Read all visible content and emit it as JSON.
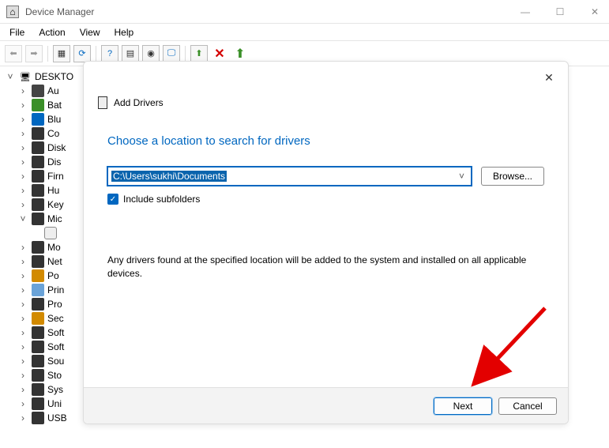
{
  "window": {
    "title": "Device Manager",
    "menus": {
      "file": "File",
      "action": "Action",
      "view": "View",
      "help": "Help"
    }
  },
  "tree": {
    "root": {
      "label": "DESKTO",
      "expanded": true
    },
    "items": [
      {
        "label": "Au",
        "color": "#444"
      },
      {
        "label": "Bat",
        "color": "#3a8f28"
      },
      {
        "label": "Blu",
        "color": "#0067c0"
      },
      {
        "label": "Co",
        "color": "#333"
      },
      {
        "label": "Disk",
        "color": "#333"
      },
      {
        "label": "Dis",
        "color": "#333"
      },
      {
        "label": "Firn",
        "color": "#333"
      },
      {
        "label": "Hu",
        "color": "#333"
      },
      {
        "label": "Key",
        "color": "#333"
      },
      {
        "label": "Mic",
        "color": "#333",
        "expanded": true,
        "child": ""
      },
      {
        "label": "Mo",
        "color": "#333"
      },
      {
        "label": "Net",
        "color": "#333"
      },
      {
        "label": "Po",
        "color": "#d28a00"
      },
      {
        "label": "Prin",
        "color": "#6aa3d8"
      },
      {
        "label": "Pro",
        "color": "#333"
      },
      {
        "label": "Sec",
        "color": "#d28a00"
      },
      {
        "label": "Soft",
        "color": "#333"
      },
      {
        "label": "Soft",
        "color": "#333"
      },
      {
        "label": "Sou",
        "color": "#333"
      },
      {
        "label": "Sto",
        "color": "#333"
      },
      {
        "label": "Sys",
        "color": "#333"
      },
      {
        "label": "Uni",
        "color": "#333"
      },
      {
        "label": "USB",
        "color": "#333"
      }
    ]
  },
  "dialog": {
    "title": "Add Drivers",
    "heading": "Choose a location to search for drivers",
    "path": "C:\\Users\\sukhi\\Documents",
    "browse": "Browse...",
    "include_subfolders": "Include subfolders",
    "hint": "Any drivers found at the specified location will be added to the system and installed on all applicable devices.",
    "next": "Next",
    "cancel": "Cancel"
  }
}
